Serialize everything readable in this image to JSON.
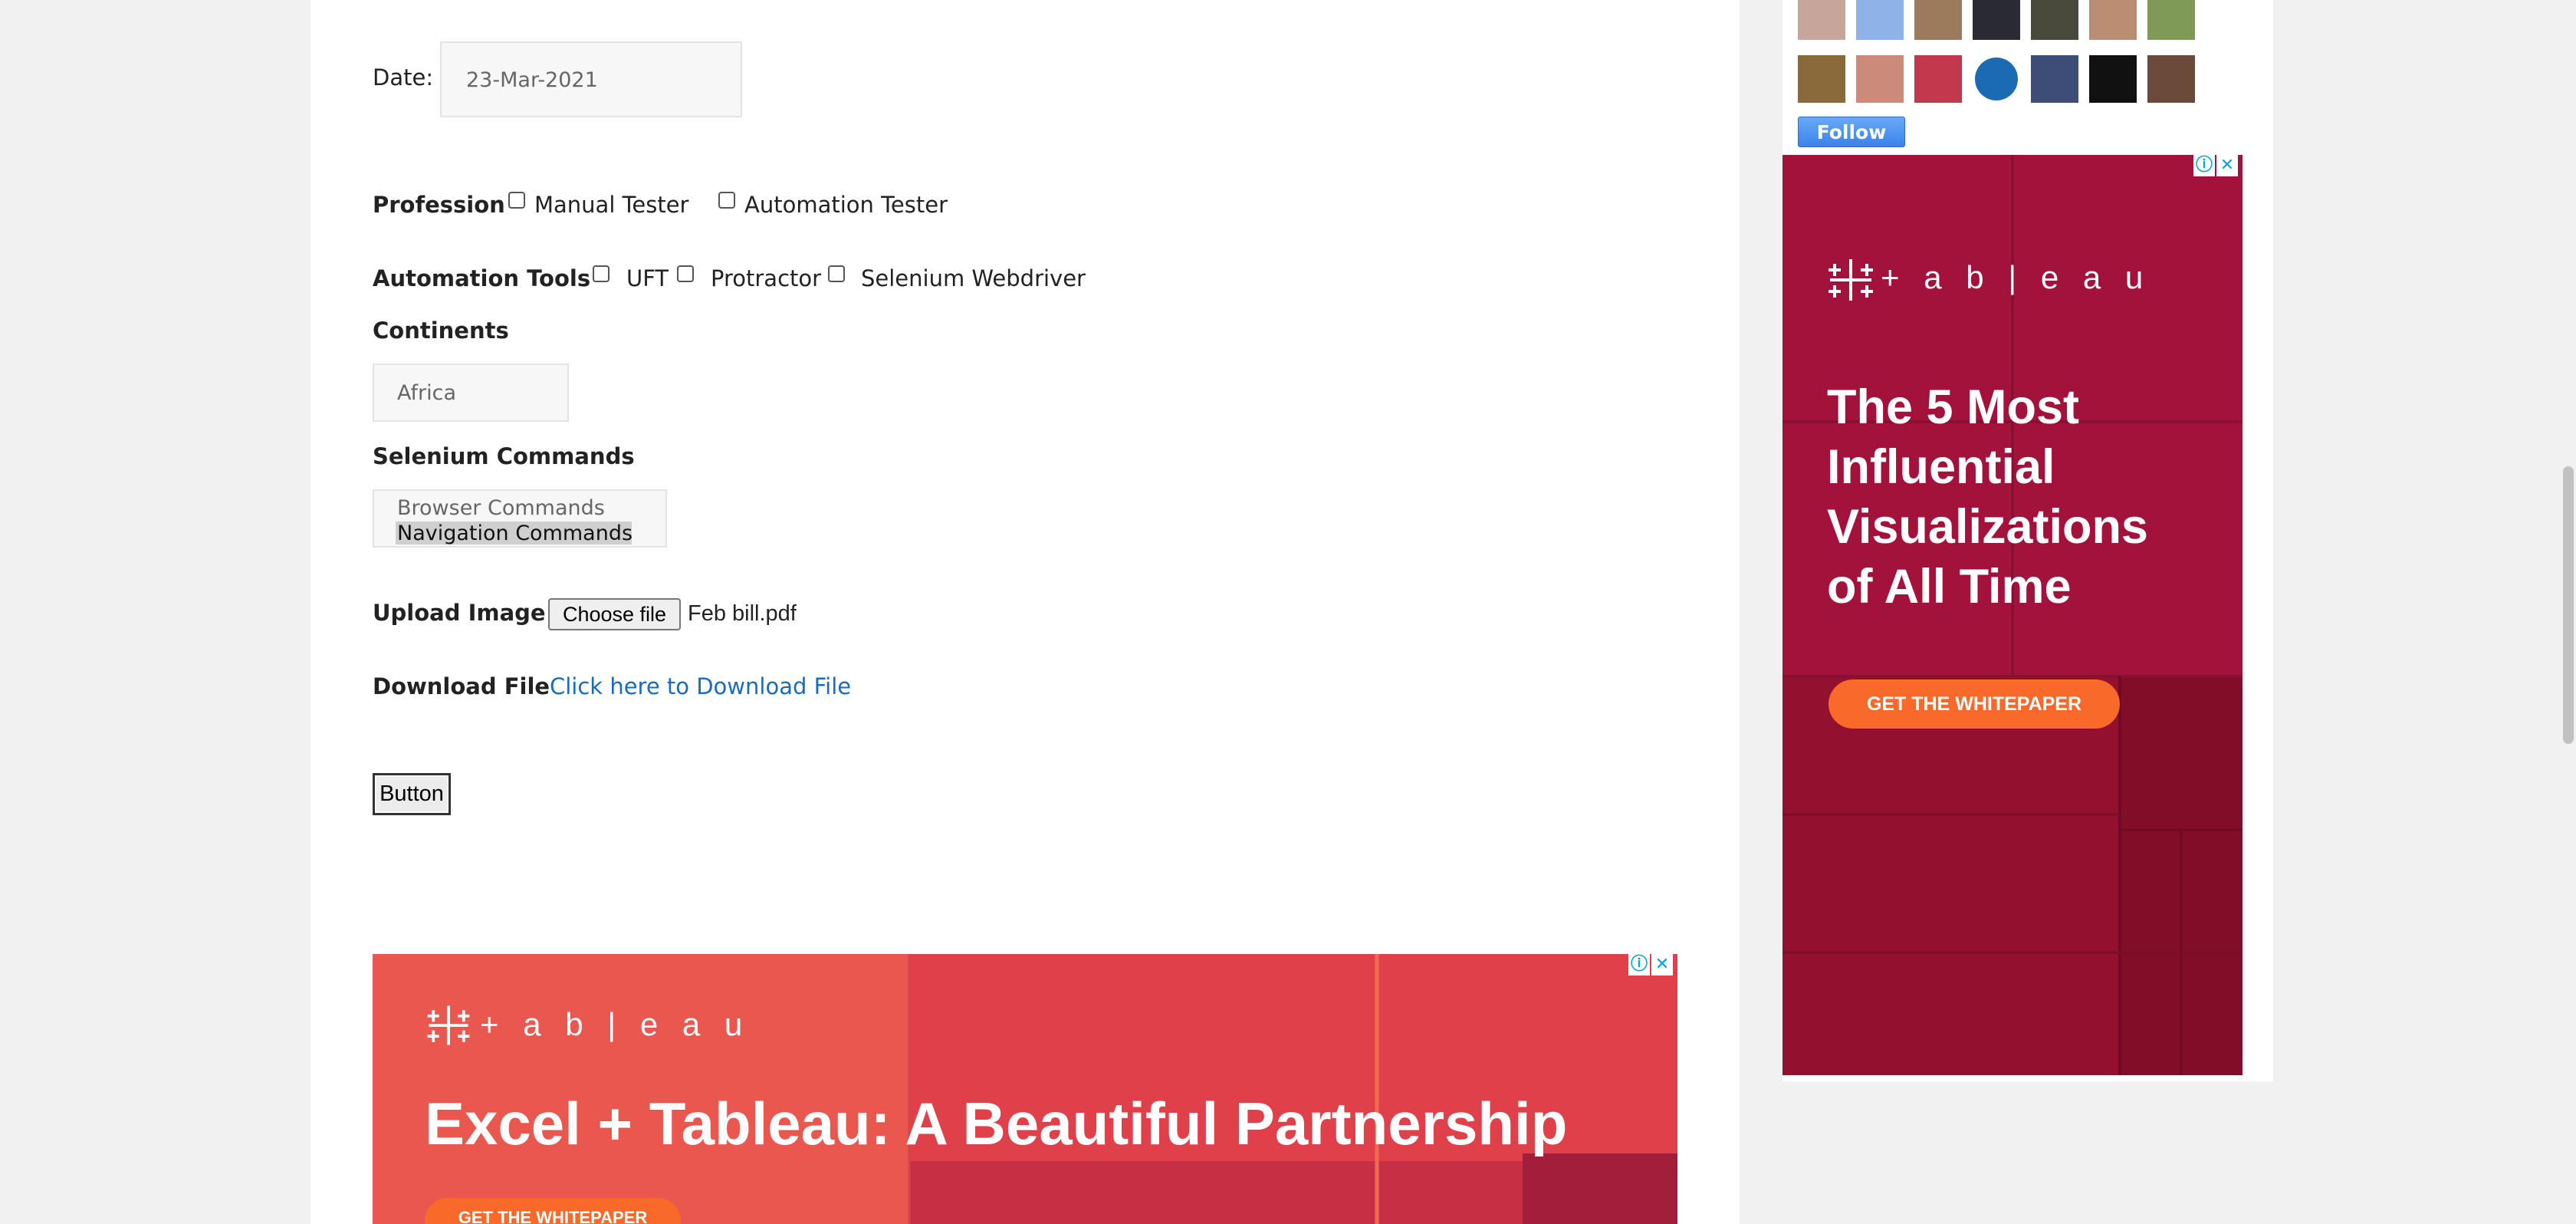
{
  "form": {
    "date_label": "Date:",
    "date_value": "23-Mar-2021",
    "profession_label": "Profession",
    "profession_options": [
      "Manual Tester",
      "Automation Tester"
    ],
    "tools_label": "Automation Tools",
    "tools_options": [
      "UFT",
      "Protractor",
      "Selenium Webdriver"
    ],
    "continents_label": "Continents",
    "continents_value": "Africa",
    "selenium_label": "Selenium Commands",
    "selenium_options": [
      "Browser Commands",
      "Navigation Commands"
    ],
    "selenium_selected": "Navigation Commands",
    "upload_label": "Upload Image",
    "choose_file_label": "Choose file",
    "file_name": "Feb bill.pdf",
    "download_label": "Download File",
    "download_link": "Click here to Download File",
    "button_label": "Button"
  },
  "sidebar": {
    "follow_label": "Follow",
    "avatars": [
      "avatar-1",
      "avatar-2",
      "avatar-3",
      "avatar-4",
      "avatar-5",
      "avatar-6",
      "avatar-7",
      "avatar-8",
      "avatar-9",
      "avatar-10",
      "avatar-11",
      "avatar-12",
      "avatar-13",
      "avatar-14"
    ]
  },
  "ads": {
    "side": {
      "brand": "+ a b | e a u",
      "headline_lines": [
        "The 5 Most",
        "Influential",
        "Visualizations",
        "of All Time"
      ],
      "cta": "GET THE WHITEPAPER"
    },
    "bottom": {
      "brand": "+ a b | e a u",
      "headline": "Excel + Tableau: A Beautiful Partnership",
      "cta": "GET THE WHITEPAPER"
    },
    "info_icon": "ⓘ",
    "close_icon": "✕"
  },
  "colors": {
    "link": "#1a6bb8",
    "ad_side_bg": "#a3123a",
    "ad_bottom_bg": "#e0424c",
    "cta": "#f96a2a",
    "follow": "#3b82ea"
  }
}
